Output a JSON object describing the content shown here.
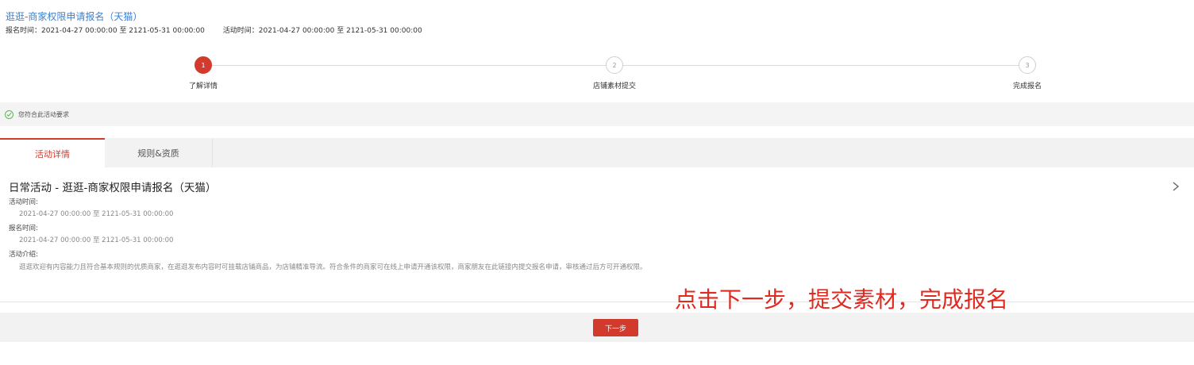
{
  "header": {
    "title": "逛逛-商家权限申请报名（天猫）",
    "signup_time": "报名时间：2021-04-27 00:00:00 至 2121-05-31 00:00:00",
    "activity_time": "活动时间：2021-04-27 00:00:00 至 2121-05-31 00:00:00"
  },
  "steps": [
    {
      "num": "1",
      "label": "了解详情",
      "active": true
    },
    {
      "num": "2",
      "label": "店铺素材提交",
      "active": false
    },
    {
      "num": "3",
      "label": "完成报名",
      "active": false
    }
  ],
  "status": {
    "text": "您符合此活动要求",
    "icon": "check-circle-icon",
    "color": "#5cb85c"
  },
  "tabs": [
    {
      "label": "活动详情",
      "active": true
    },
    {
      "label": "规则&资质",
      "active": false
    }
  ],
  "detail": {
    "title": "日常活动 - 逛逛-商家权限申请报名（天猫）",
    "activity_time_label": "活动时间:",
    "activity_time_value": "2021-04-27 00:00:00 至 2121-05-31 00:00:00",
    "signup_time_label": "报名时间:",
    "signup_time_value": "2021-04-27 00:00:00 至 2121-05-31 00:00:00",
    "intro_label": "活动介绍:",
    "intro_value": "逛逛欢迎有内容能力且符合基本规则的优质商家，在逛逛发布内容时可挂载店铺商品，为店铺精准导流。符合条件的商家可在线上申请开通该权限，商家朋友在此链接内提交报名申请，审核通过后方可开通权限。"
  },
  "annotation": "点击下一步，提交素材，完成报名",
  "footer": {
    "next_label": "下一步"
  },
  "colors": {
    "accent": "#d23a2e",
    "link": "#3d7fd0"
  }
}
